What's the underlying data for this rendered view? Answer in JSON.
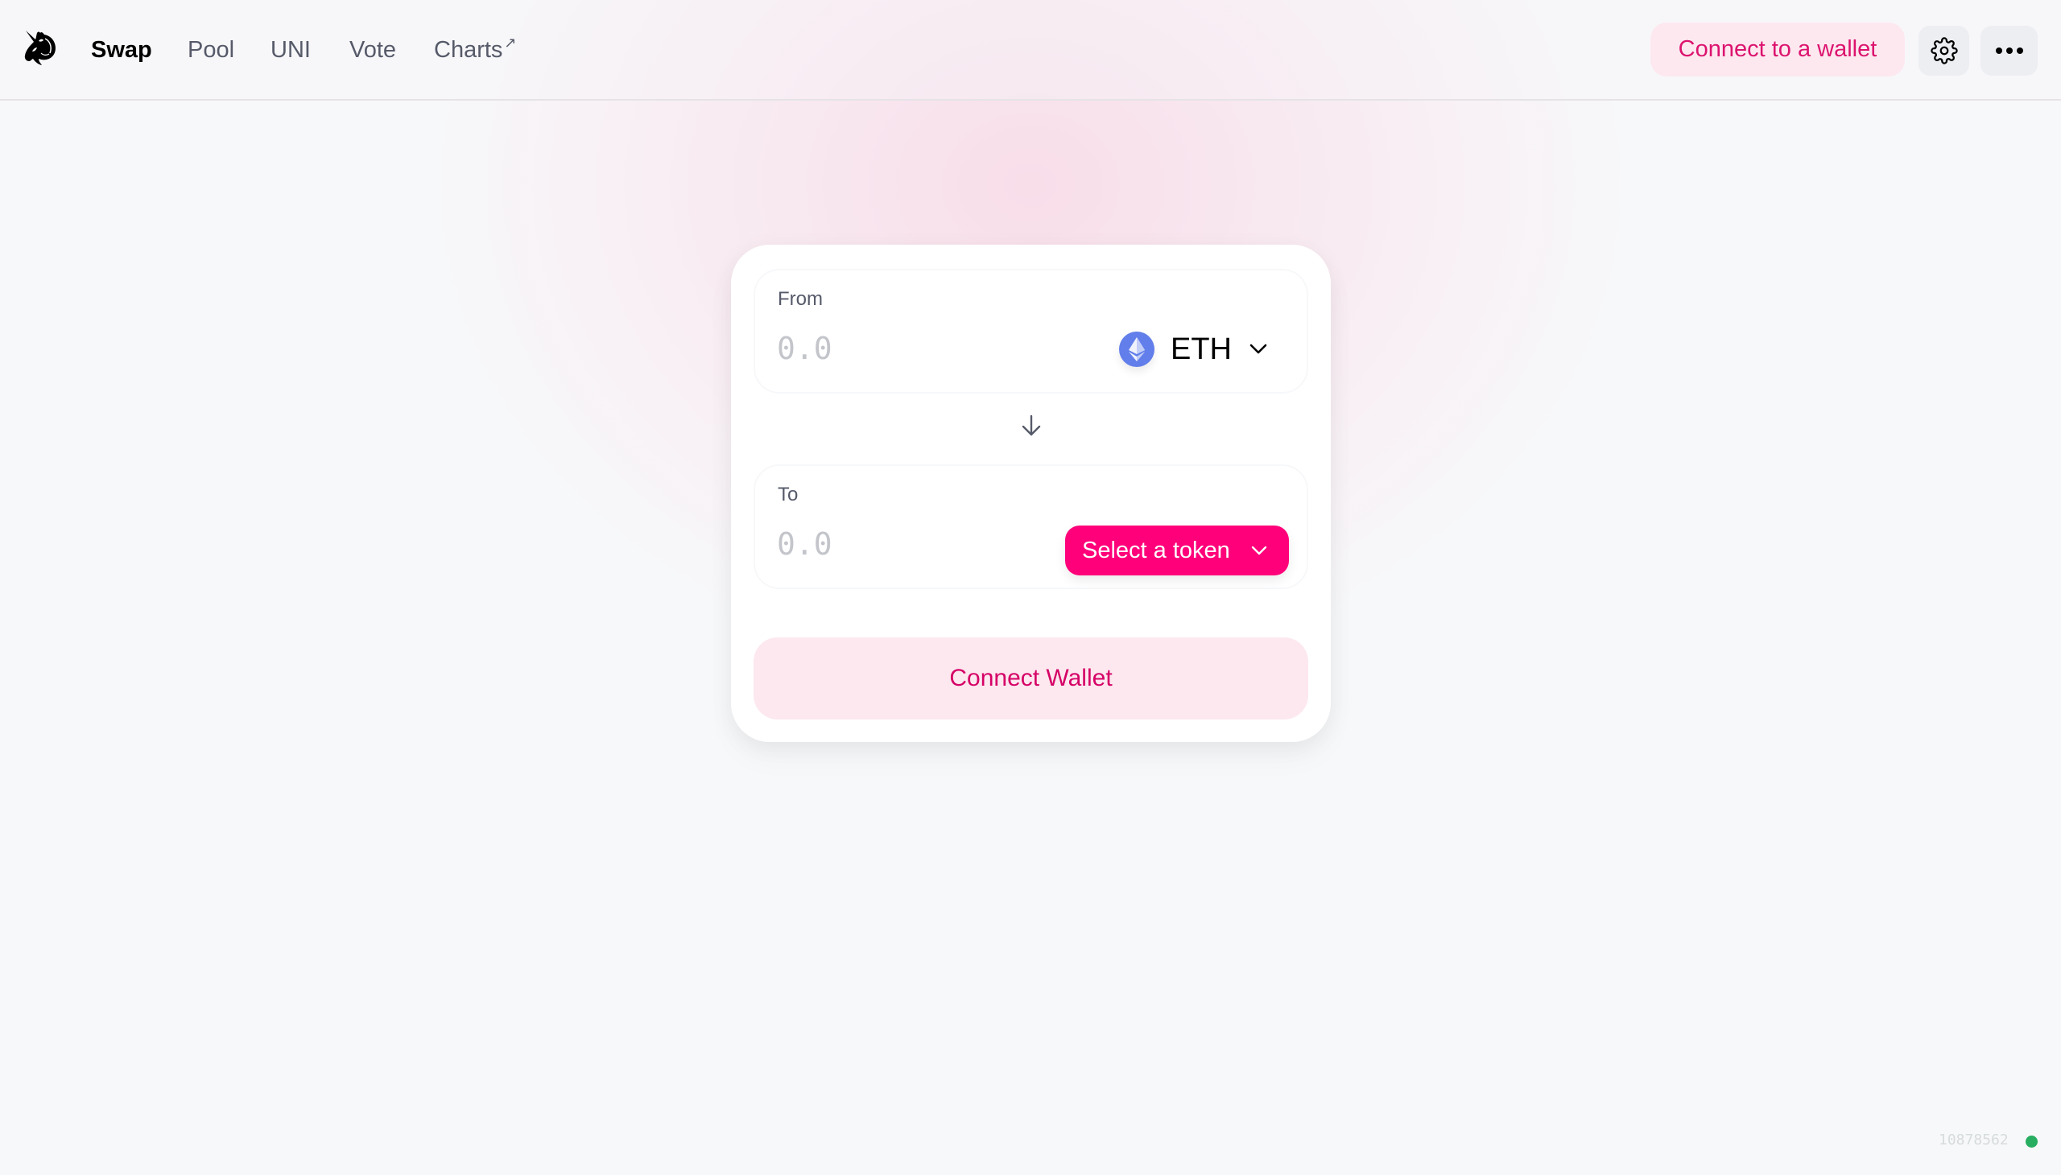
{
  "header": {
    "logo": "uniswap-unicorn-logo",
    "nav": [
      {
        "label": "Swap",
        "active": true
      },
      {
        "label": "Pool",
        "active": false
      },
      {
        "label": "UNI",
        "active": false
      },
      {
        "label": "Vote",
        "active": false
      },
      {
        "label": "Charts",
        "active": false,
        "external": true
      }
    ],
    "external_link_glyph": "↗",
    "connect_label": "Connect to a wallet",
    "settings_icon": "gear-icon",
    "more_icon": "ellipsis-icon"
  },
  "swap": {
    "from": {
      "label": "From",
      "amount_placeholder": "0.0",
      "amount_value": "",
      "token": {
        "symbol": "ETH",
        "icon": "ethereum-icon",
        "color": "#627eea"
      }
    },
    "arrow_icon": "arrow-down-icon",
    "to": {
      "label": "To",
      "amount_placeholder": "0.0",
      "amount_value": "",
      "select_label": "Select a token"
    },
    "connect_wallet_label": "Connect Wallet"
  },
  "footer": {
    "block_number": "10878562",
    "status": "connected"
  },
  "colors": {
    "accent": "#ff007a",
    "accent_text": "#dc136f",
    "accent_light": "#fde8ef",
    "status_green": "#27ae60"
  }
}
